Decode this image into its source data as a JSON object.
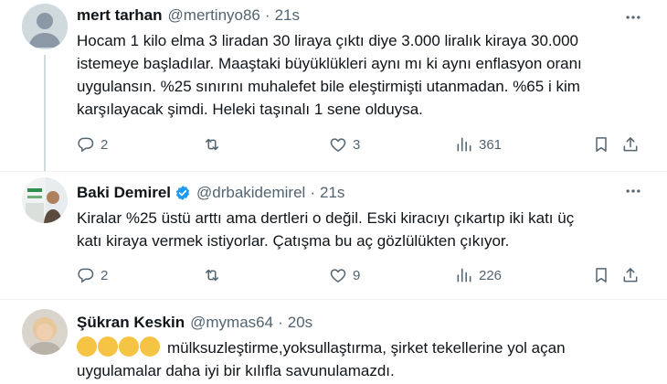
{
  "colors": {
    "accent": "#1d9bf0",
    "text": "#0f1419",
    "muted": "#536471",
    "border": "#eff3f4"
  },
  "tweets": [
    {
      "name": "mert tarhan",
      "handle": "@mertinyo86",
      "dot": "·",
      "time": "21s",
      "verified": false,
      "avatar": "default-avatar",
      "lines": [
        "Hocam 1 kilo elma 3 liradan 30 liraya çıktı diye 3.000 liralık kiraya 30.000",
        "istemeye başladılar. Maaştaki büyüklükleri aynı mı ki aynı enflasyon oranı",
        "uygulansın. %25 sınırını  muhalefet bile eleştirmişti utanmadan. %65 i kim",
        "karşılayacak şimdi. Heleki taşınalı 1 sene olduysa."
      ],
      "stats": {
        "replies": "2",
        "retweets": "",
        "likes": "3",
        "views": "361"
      }
    },
    {
      "name": "Baki Demirel",
      "handle": "@drbakidemirel",
      "dot": "·",
      "time": "21s",
      "verified": true,
      "avatar": "profile-photo",
      "lines": [
        "Kiralar %25 üstü arttı ama dertleri o değil. Eski kiracıyı çıkartıp iki katı üç",
        "katı kiraya vermek istiyorlar.  Çatışma bu aç gözlülükten çıkıyor."
      ],
      "stats": {
        "replies": "2",
        "retweets": "",
        "likes": "9",
        "views": "226"
      }
    },
    {
      "name": "Şükran Keskin",
      "handle": "@mymas64",
      "dot": "·",
      "time": "20s",
      "verified": false,
      "avatar": "profile-photo",
      "lines": [
        "mülksuzleştirme,yoksullaştırma, şirket tekellerine yol açan",
        "uygulamalar daha iyi bir kılıfla savunulamazdı."
      ],
      "emojis": [
        "clapping-hands-icon",
        "clapping-hands-icon",
        "clapping-hands-icon",
        "clapping-hands-icon"
      ]
    }
  ]
}
